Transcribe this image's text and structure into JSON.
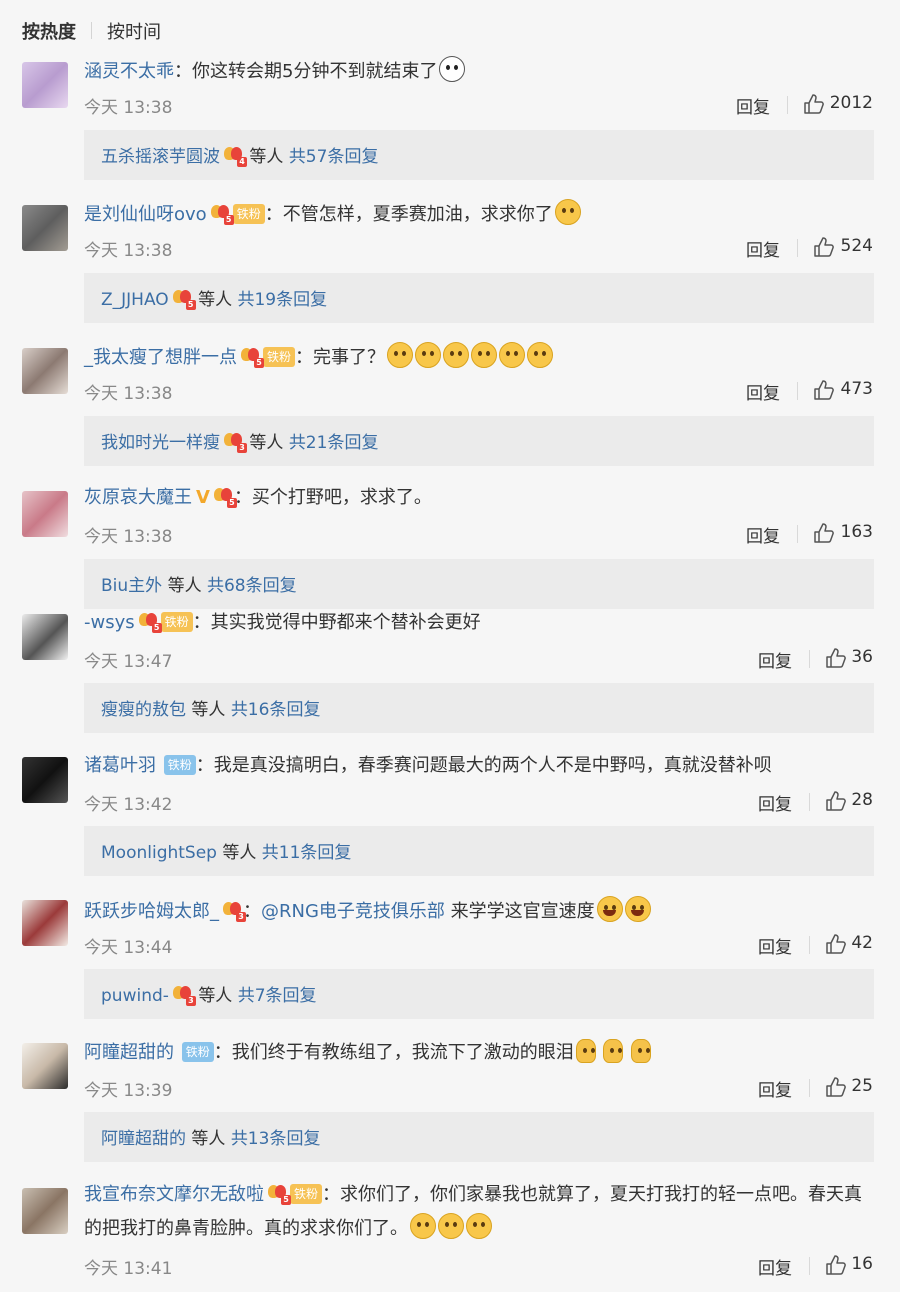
{
  "sort": {
    "hot": "按热度",
    "time": "按时间"
  },
  "labels": {
    "reply": "回复",
    "etc": "等人"
  },
  "comments": [
    {
      "name": "涵灵不太乖",
      "text": "：你这转会期5分钟不到就结束了",
      "time": "今天 13:38",
      "likes": "2012",
      "sub_name": "五杀摇滚芋圆波",
      "sub_total": "共57条回复"
    },
    {
      "name": "是刘仙仙呀ovo",
      "fan": "铁粉",
      "text": "：不管怎样，夏季赛加油，求求你了",
      "time": "今天 13:38",
      "likes": "524",
      "sub_name": "Z_JJHAO",
      "sub_total": "共19条回复"
    },
    {
      "name": "_我太瘦了想胖一点",
      "fan": "铁粉",
      "text": "：完事了？",
      "time": "今天 13:38",
      "likes": "473",
      "sub_name": "我如时光一样瘦",
      "sub_total": "共21条回复"
    },
    {
      "name": "灰原哀大魔王",
      "text": "：买个打野吧，求求了。",
      "time": "今天 13:38",
      "likes": "163",
      "sub_name": "Biu主外",
      "sub_total": "共68条回复"
    },
    {
      "name": "-wsys",
      "fan": "铁粉",
      "text": "：其实我觉得中野都来个替补会更好",
      "time": "今天 13:47",
      "likes": "36",
      "sub_name": "瘦瘦的敖包",
      "sub_total": "共16条回复"
    },
    {
      "name": "诸葛叶羽",
      "fan": "铁粉",
      "text": "：我是真没搞明白，春季赛问题最大的两个人不是中野吗，真就没替补呗",
      "time": "今天 13:42",
      "likes": "28",
      "sub_name": "MoonlightSep",
      "sub_total": "共11条回复"
    },
    {
      "name": "跃跃步哈姆太郎_",
      "mention": "@RNG电子竞技俱乐部",
      "text": "：",
      "text2": " 来学学这官宣速度",
      "time": "今天 13:44",
      "likes": "42",
      "sub_name": "puwind-",
      "sub_total": "共7条回复"
    },
    {
      "name": "阿瞳超甜的",
      "fan": "铁粉",
      "text": "：我们终于有教练组了，我流下了激动的眼泪",
      "time": "今天 13:39",
      "likes": "25",
      "sub_name": "阿瞳超甜的",
      "sub_total": "共13条回复"
    },
    {
      "name": "我宣布奈文摩尔无敌啦",
      "fan": "铁粉",
      "text": "：求你们了，你们家暴我也就算了，夏天打我打的轻一点吧。春天真的把我打的鼻青脸肿。真的求求你们了。",
      "time": "今天 13:41",
      "likes": "16"
    }
  ],
  "colors": {
    "link": "#3b6ea5",
    "background": "#f6f6f6",
    "subbox": "#ebebeb",
    "time": "#888888"
  }
}
